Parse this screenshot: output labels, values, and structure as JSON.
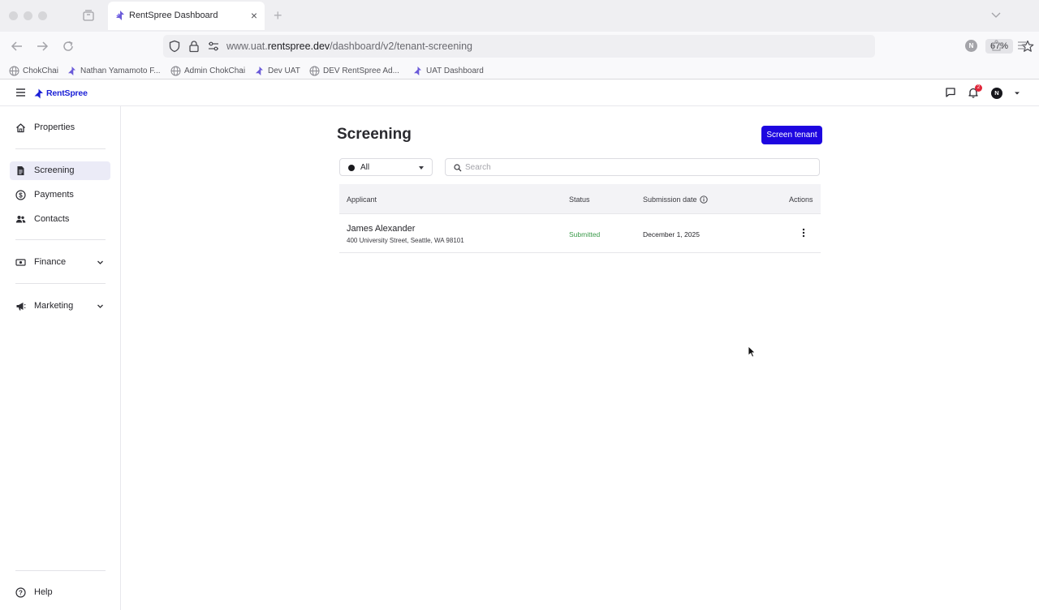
{
  "browser": {
    "tab_title": "RentSpree Dashboard",
    "tab_close": "×",
    "new_tab": "+",
    "url_prefix": "www.uat.",
    "url_domain": "rentspree.dev",
    "url_path": "/dashboard/v2/tenant-screening",
    "zoom": "67%",
    "profile_initial": "N",
    "bookmarks": [
      {
        "label": "ChokChai",
        "icon": "globe-icon"
      },
      {
        "label": "Nathan Yamamoto F...",
        "icon": "rentspree-icon"
      },
      {
        "label": "Admin ChokChai",
        "icon": "globe-icon"
      },
      {
        "label": "Dev UAT",
        "icon": "rentspree-icon"
      },
      {
        "label": "DEV RentSpree Ad...",
        "icon": "globe-icon"
      },
      {
        "label": "UAT Dashboard",
        "icon": "rentspree-icon"
      }
    ]
  },
  "header": {
    "brand": "RentSpree",
    "notification_count": "2",
    "avatar_initial": "N"
  },
  "sidebar": {
    "items": [
      {
        "label": "Properties",
        "icon": "home-icon"
      },
      {
        "label": "Screening",
        "icon": "document-icon",
        "active": true
      },
      {
        "label": "Payments",
        "icon": "dollar-icon"
      },
      {
        "label": "Contacts",
        "icon": "people-icon"
      },
      {
        "label": "Finance",
        "icon": "money-icon"
      },
      {
        "label": "Marketing",
        "icon": "megaphone-icon"
      }
    ],
    "help": "Help"
  },
  "main": {
    "title": "Screening",
    "screen_button": "Screen tenant",
    "filter_value": "All",
    "search_placeholder": "Search",
    "table": {
      "headers": {
        "applicant": "Applicant",
        "status": "Status",
        "submission_date": "Submission date",
        "actions": "Actions"
      },
      "rows": [
        {
          "name": "James Alexander",
          "address": "400 University Street, Seattle, WA 98101",
          "status": "Submitted",
          "date": "December 1, 2025"
        }
      ]
    }
  },
  "colors": {
    "brand": "#1a1fd6",
    "primary_button": "#1d06e0",
    "status_submitted": "#3a9a49",
    "notification": "#e0263a"
  }
}
